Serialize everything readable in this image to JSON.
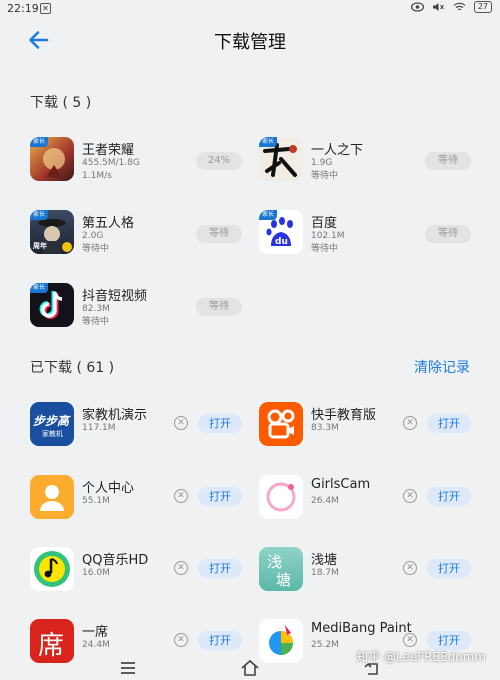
{
  "status": {
    "time": "22:19",
    "notif_glyph": "✕",
    "battery": "27"
  },
  "header": {
    "title": "下载管理"
  },
  "downloading": {
    "heading": "下载 ( 5 )",
    "items": [
      {
        "name": "王者荣耀",
        "line1": "455.5M/1.8G",
        "line2": "1.1M/s",
        "action": "24%",
        "badge": "家长"
      },
      {
        "name": "一人之下",
        "line1": "1.9G",
        "line2": "等待中",
        "action": "等待",
        "badge": "家长"
      },
      {
        "name": "第五人格",
        "line1": "2.0G",
        "line2": "等待中",
        "action": "等待",
        "badge": "家长"
      },
      {
        "name": "百度",
        "line1": "102.1M",
        "line2": "等待中",
        "action": "等待",
        "badge": "家长"
      },
      {
        "name": "抖音短视频",
        "line1": "82.3M",
        "line2": "等待中",
        "action": "等待",
        "badge": "家长"
      }
    ]
  },
  "downloaded": {
    "heading": "已下载 ( 61 )",
    "clear_label": "清除记录",
    "items": [
      {
        "name": "家教机演示",
        "size": "117.1M",
        "action": "打开"
      },
      {
        "name": "快手教育版",
        "size": "83.3M",
        "action": "打开"
      },
      {
        "name": "个人中心",
        "size": "55.1M",
        "action": "打开"
      },
      {
        "name": "GirlsCam",
        "size": "26.4M",
        "action": "打开"
      },
      {
        "name": "QQ音乐HD",
        "size": "16.0M",
        "action": "打开"
      },
      {
        "name": "浅塘",
        "size": "18.7M",
        "action": "打开"
      },
      {
        "name": "一席",
        "size": "24.4M",
        "action": "打开"
      },
      {
        "name": "MediBang Paint",
        "size": "25.2M",
        "action": "打开"
      }
    ]
  },
  "icon_text": {
    "bubugao_line1": "步步高",
    "bubugao_line2": "家教机",
    "qianting_line1": "浅",
    "qianting_line2": "塘",
    "yixi": "席",
    "diwu_badge": "周年",
    "baidu_text": "du"
  },
  "watermark": "知乎 @LeeFREEdomm",
  "colors": {
    "accent": "#1e7be0",
    "background": "#f0f1f3"
  }
}
